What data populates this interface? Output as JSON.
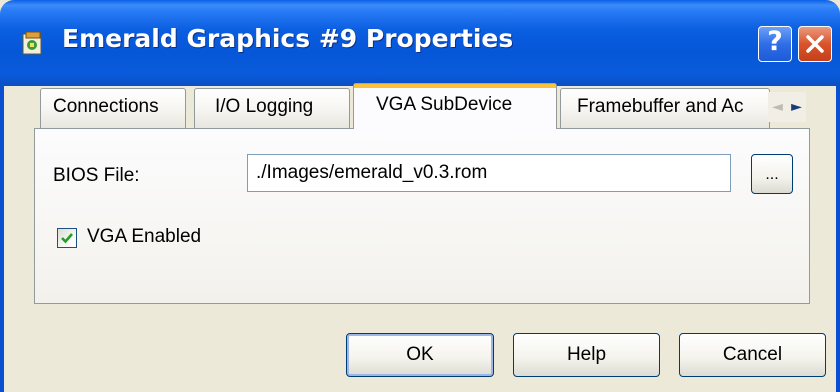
{
  "window": {
    "title": "Emerald Graphics #9 Properties",
    "help_button": "?",
    "app_icon": "properties-icon",
    "close_icon": "close-icon"
  },
  "tabs": [
    {
      "label": "Connections",
      "selected": false
    },
    {
      "label": "I/O Logging",
      "selected": false
    },
    {
      "label": "VGA SubDevice",
      "selected": true
    },
    {
      "label": "Framebuffer and Ac",
      "selected": false
    }
  ],
  "tab_scroll": {
    "left": "◄",
    "right": "►"
  },
  "panel": {
    "bios_label": "BIOS File:",
    "bios_value": "./Images/emerald_v0.3.rom",
    "browse_label": "...",
    "vga_enabled_label": "VGA Enabled",
    "vga_enabled_checked": true
  },
  "buttons": {
    "ok": "OK",
    "help": "Help",
    "cancel": "Cancel"
  },
  "colors": {
    "titlebar": "#0a5ee0",
    "selected_tab_accent": "#fbc13a",
    "close_button": "#d9542a",
    "dialog_bg": "#ece9d8"
  }
}
